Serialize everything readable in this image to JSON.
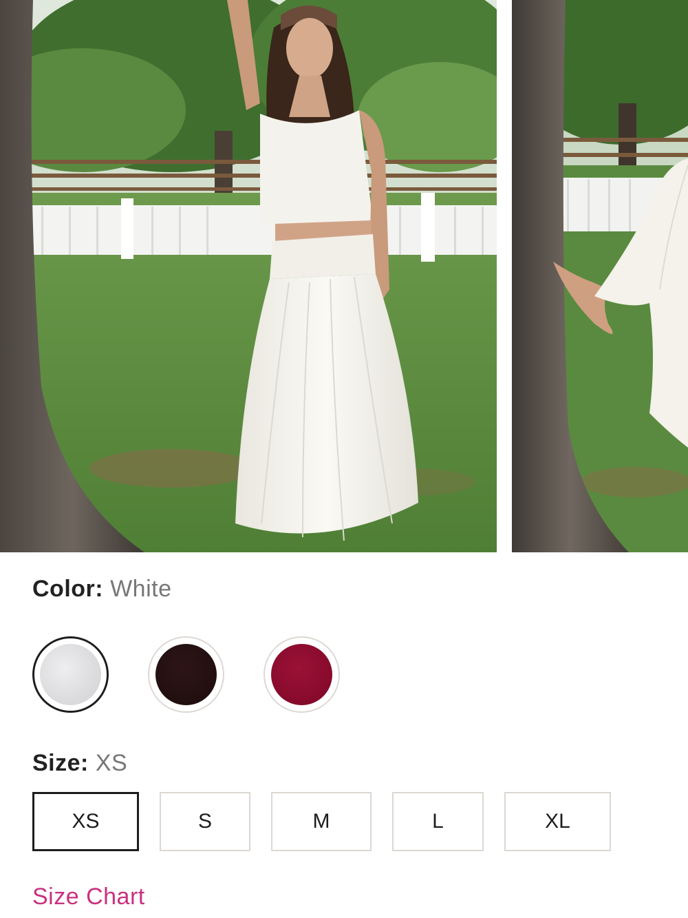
{
  "gallery": {
    "images": [
      {
        "name": "model-front-view",
        "subject": "model in white cami top and white maxi skirt by a tree"
      },
      {
        "name": "skirt-detail-view",
        "subject": "white skirt hem and bare foot against tree"
      }
    ]
  },
  "color": {
    "label": "Color:",
    "selected": "White",
    "swatches": [
      {
        "name": "White",
        "hex": "#e2e1e3",
        "selected": true
      },
      {
        "name": "Black",
        "hex": "#231011",
        "selected": false
      },
      {
        "name": "Burgundy",
        "hex": "#8a0b2d",
        "selected": false
      }
    ]
  },
  "size": {
    "label": "Size:",
    "selected": "XS",
    "options": [
      "XS",
      "S",
      "M",
      "L",
      "XL"
    ]
  },
  "size_chart": {
    "label": "Size Chart",
    "color": "#c9317f"
  }
}
